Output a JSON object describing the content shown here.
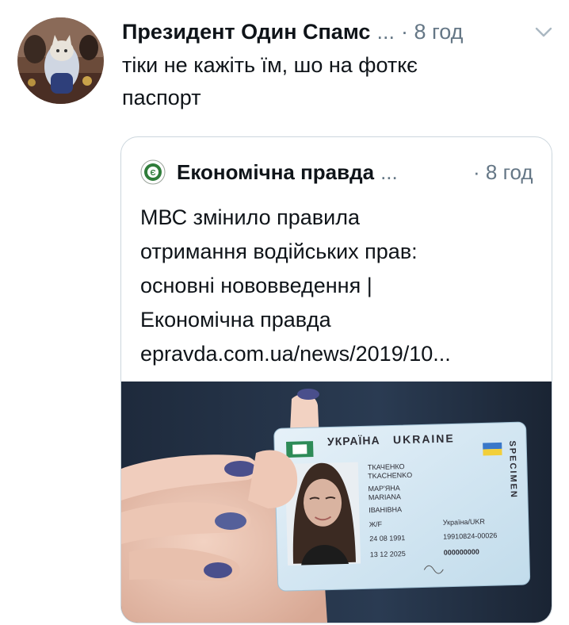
{
  "tweet": {
    "author_name": "Президент Один Спамс",
    "ellipsis": "...",
    "time": "· 8 год",
    "text_lines": [
      "тіки не кажіть їм, шо на фоткє",
      "паспорт"
    ]
  },
  "quoted": {
    "source_name": "Економічна правда",
    "ellipsis": "...",
    "time": "· 8 год",
    "text_lines": [
      "МВС змінило правила",
      "отримання водійських прав:",
      "основні нововведення |",
      "Економічна правда",
      "epravda.com.ua/news/2019/10..."
    ]
  },
  "id_card": {
    "country_ua": "УКРАЇНА",
    "country_en": "UKRAINE",
    "specimen": "SPECIMEN",
    "surname_ua": "ТКАЧЕНКО",
    "surname_en": "TKACHENKO",
    "given_ua": "МАР'ЯНА",
    "given_en": "MARIANA",
    "patronymic": "ІВАНІВНА",
    "sex": "Ж/F",
    "nationality": "Україна/UKR",
    "birth_date": "24 08 1991",
    "record_no": "19910824-00026",
    "expiry": "13 12 2025",
    "doc_no": "000000000"
  },
  "icons": {
    "chevron": "chevron-down-icon",
    "source_logo": "epravda-logo-icon"
  },
  "colors": {
    "text": "#0f1419",
    "secondary": "#657786",
    "border": "#ccd6dd",
    "card_blue": "#cfe3ef",
    "nail_polish": "#4a4f8c"
  }
}
